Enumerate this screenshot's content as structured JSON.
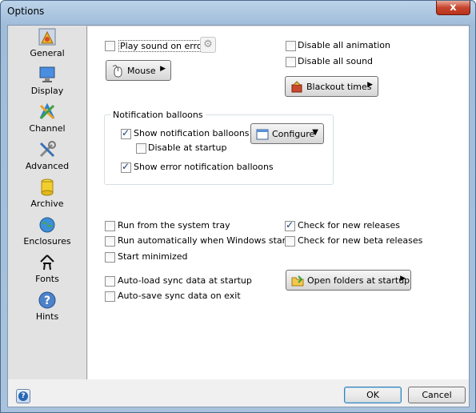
{
  "window": {
    "title": "Options",
    "close_glyph": "x"
  },
  "sidebar": {
    "items": [
      {
        "label": "General",
        "icon": "general-icon"
      },
      {
        "label": "Display",
        "icon": "display-icon"
      },
      {
        "label": "Channel",
        "icon": "channel-icon"
      },
      {
        "label": "Advanced",
        "icon": "advanced-icon"
      },
      {
        "label": "Archive",
        "icon": "archive-icon"
      },
      {
        "label": "Enclosures",
        "icon": "enclosures-icon"
      },
      {
        "label": "Fonts",
        "icon": "fonts-icon"
      },
      {
        "label": "Hints",
        "icon": "hints-icon"
      }
    ]
  },
  "general": {
    "play_sound": {
      "label": "Play sound on error",
      "checked": false
    },
    "mouse_button": "Mouse",
    "disable_animation": {
      "label": "Disable all animation",
      "checked": false
    },
    "disable_sound": {
      "label": "Disable all sound",
      "checked": false
    },
    "blackout_button": "Blackout times",
    "notification_group": {
      "title": "Notification balloons",
      "show_balloons": {
        "label": "Show notification balloons",
        "checked": true
      },
      "disable_startup": {
        "label": "Disable at startup",
        "checked": false
      },
      "show_error_balloons": {
        "label": "Show error notification balloons",
        "checked": true
      },
      "configure_button": "Configure"
    },
    "run_tray": {
      "label": "Run from the system tray",
      "checked": false
    },
    "run_auto": {
      "label": "Run automatically when Windows starts",
      "checked": false
    },
    "start_min": {
      "label": "Start minimized",
      "checked": false
    },
    "check_releases": {
      "label": "Check for new releases",
      "checked": true
    },
    "check_beta": {
      "label": "Check for new beta releases",
      "checked": false
    },
    "autoload": {
      "label": "Auto-load sync data at startup",
      "checked": false
    },
    "autosave": {
      "label": "Auto-save sync data on exit",
      "checked": false
    },
    "open_folders_button": "Open folders at startup"
  },
  "footer": {
    "ok": "OK",
    "cancel": "Cancel",
    "help_glyph": "?"
  },
  "colors": {
    "accent": "#2b66b3",
    "window_frame": "#a9c3de",
    "close_red": "#c7452d"
  }
}
